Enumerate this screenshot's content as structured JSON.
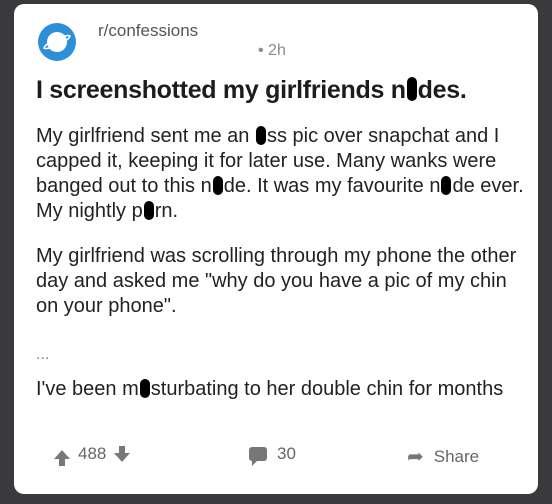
{
  "header": {
    "subreddit": "r/confessions",
    "age": "• 2h"
  },
  "post": {
    "title": [
      "I screenshotted my girlfriends n",
      "des."
    ],
    "p1": [
      "My girlfriend sent me an ",
      "ss pic over snapchat and I capped it, keeping it for later use. Many wanks were banged out to this n",
      "de. It was my favourite n",
      "de ever. My nightly p",
      "rn."
    ],
    "p2": "My girlfriend was scrolling through my phone the other day and asked me \"why do you have a pic of my chin on your phone\".",
    "ellipsis": "...",
    "p3": [
      "I've been m",
      "sturbating to her double chin for months"
    ]
  },
  "actions": {
    "votes": "488",
    "comments": "30",
    "share": "Share"
  },
  "icons": {
    "avatar": "reddit-planet-icon",
    "upvote": "arrow-up-icon",
    "downvote": "arrow-down-icon",
    "comment": "comment-bubble-icon",
    "share": "share-arrow-icon"
  },
  "colors": {
    "avatar": "#2f8ed8"
  }
}
